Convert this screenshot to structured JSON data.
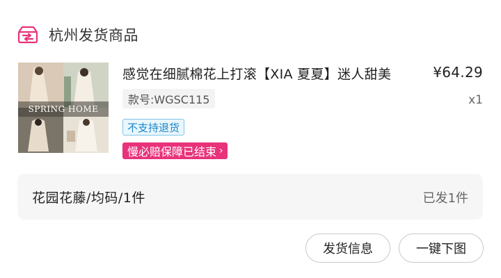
{
  "header": {
    "warehouse_title": "杭州发货商品",
    "icon": "shipping-box-icon",
    "icon_color": "#e8327a"
  },
  "product": {
    "title": "感觉在细腻棉花上打滚【XIA 夏夏】迷人甜美",
    "price": "¥64.29",
    "quantity": "x1",
    "sku": "款号:WGSC115",
    "thumbnail_text": "SPRING HOME",
    "return_tag": "不支持退货",
    "guarantee_tag": "慢必赔保障已结束",
    "guarantee_chevron": "›"
  },
  "variant": {
    "spec": "花园花藤/均码/1件",
    "status": "已发1件"
  },
  "actions": {
    "shipping_info": "发货信息",
    "download_images": "一键下图"
  },
  "colors": {
    "accent": "#e8327a",
    "return_tag_text": "#1a86c7",
    "return_tag_border": "#7fc4e8"
  }
}
